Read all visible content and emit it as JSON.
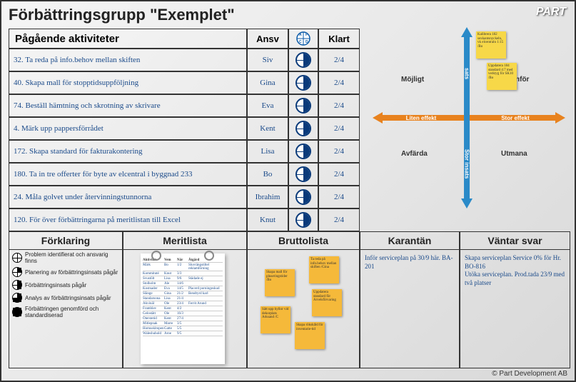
{
  "title": "Förbättringsgrupp \"Exemplet\"",
  "logo": "PART",
  "copyright": "© Part Development AB",
  "headers": {
    "activities": "Pågående aktiviteter",
    "owner": "Ansv",
    "pdca": "",
    "done": "Klart"
  },
  "activities": [
    {
      "num": "32.",
      "task": "Ta reda på info.behov mellan skiften",
      "owner": "Siv",
      "done": "2/4",
      "pdca": 2
    },
    {
      "num": "40.",
      "task": "Skapa mall för stopptidsuppföljning",
      "owner": "Gina",
      "done": "2/4",
      "pdca": 2
    },
    {
      "num": "74.",
      "task": "Beställ hämtning och skrotning av skrivare",
      "owner": "Eva",
      "done": "2/4",
      "pdca": 2
    },
    {
      "num": "4.",
      "task": "Märk upp pappersförrådet",
      "owner": "Kent",
      "done": "2/4",
      "pdca": 2
    },
    {
      "num": "172.",
      "task": "Skapa standard för fakturakontering",
      "owner": "Lisa",
      "done": "2/4",
      "pdca": 2
    },
    {
      "num": "180.",
      "task": "Ta in tre offerter för byte av elcentral i byggnad 233",
      "owner": "Bo",
      "done": "2/4",
      "pdca": 2
    },
    {
      "num": "24.",
      "task": "Måla golvet under återvinningstunnorna",
      "owner": "Ibrahim",
      "done": "2/4",
      "pdca": 2
    },
    {
      "num": "120.",
      "task": "För över förbättringarna på meritlistan till Excel",
      "owner": "Knut",
      "done": "2/4",
      "pdca": 2
    }
  ],
  "sections": {
    "forklaring": "Förklaring",
    "meritlista": "Meritlista",
    "bruttolista": "Bruttolista",
    "karantan": "Karantän",
    "vantar": "Väntar svar"
  },
  "legend": [
    "Problem identifierat och ansvarig finns",
    "Planering av förbättringsinsats pågår",
    "Förbättringsinsats pågår",
    "Analys av förbättringsinsats pågår",
    "Förbättringen genomförd och standardiserad"
  ],
  "quadrant": {
    "top_left": "Möjligt",
    "top_right": "nför",
    "bottom_left": "Avfärda",
    "bottom_right": "Utmana",
    "axis_left": "Liten effekt",
    "axis_right": "Stor effekt",
    "axis_top": "sats",
    "axis_bottom": "Stor insats",
    "sticky1": "Kalibrera 182 sexkantsnyckeln, vk elcentraln 1:15 /Bo",
    "sticky2": "Uppdatera 184 standard 4:7 med verktyg för SK10 /Bo"
  },
  "bruttolista_stickies": [
    "Skapa mall för pluseringstider /Bo",
    "Sätt upp hyllor vid dekorplats Arksand /C",
    "Ta reda på info.behov mellan skiften /Gina",
    "Uppdatera standard för Arvelsförvaring",
    "Skapa rökskåld för inventarie-tid"
  ],
  "karantan_text": "Inför serviceplan på 30/9 här. BA-201",
  "vantar_text": "Skapa serviceplan Service 0% för Hr. BO-816\nUtöka serviceplan. Prod.tada 23/9 med två platser",
  "meritlista": {
    "headers": {
      "c1": "Aktivitet",
      "c2": "Vem",
      "c3": "När",
      "c4": "Åtgärd"
    },
    "rows": [
      {
        "c1": "Märk",
        "c2": "Bo",
        "c3": "1/2",
        "c4": "Sluvrängstiltel reklamförning"
      },
      {
        "c1": "Kommituté",
        "c2": "Knut",
        "c3": "3/3",
        "c4": ""
      },
      {
        "c1": "Svustölt",
        "c2": "Lisa",
        "c3": "9/6",
        "c4": "Städade ej"
      },
      {
        "c1": "Stolholm",
        "c2": "Ale",
        "c3": "14/6",
        "c4": ""
      },
      {
        "c1": "Kostnader",
        "c2": "Eva",
        "c3": "14/5",
        "c4": "Placerd porningeskud"
      },
      {
        "c1": "Slänge",
        "c2": "Gina",
        "c3": "21/2",
        "c4": "Bendtyrd karl"
      },
      {
        "c1": "Standarsona",
        "c2": "Lisa",
        "c3": "21/4",
        "c4": ""
      },
      {
        "c1": "Akvinäl",
        "c2": "Ole",
        "c3": "23/4",
        "c4": "Ferrit Arund"
      },
      {
        "c1": "Framblev",
        "c2": "Kent",
        "c3": "4/2",
        "c4": ""
      },
      {
        "c1": "Gelostätt",
        "c2": "Ole",
        "c3": "16/3",
        "c4": ""
      },
      {
        "c1": "Oterstetid",
        "c2": "Kent",
        "c3": "27/4",
        "c4": ""
      },
      {
        "c1": "Mitlepnak",
        "c2": "Marre",
        "c3": "3/5",
        "c4": ""
      },
      {
        "c1": "Homuskitopen",
        "c2": "Gatte",
        "c3": "5/5",
        "c4": ""
      },
      {
        "c1": "Waleshuhold",
        "c2": "Aroe",
        "c3": "9/5",
        "c4": ""
      }
    ]
  }
}
